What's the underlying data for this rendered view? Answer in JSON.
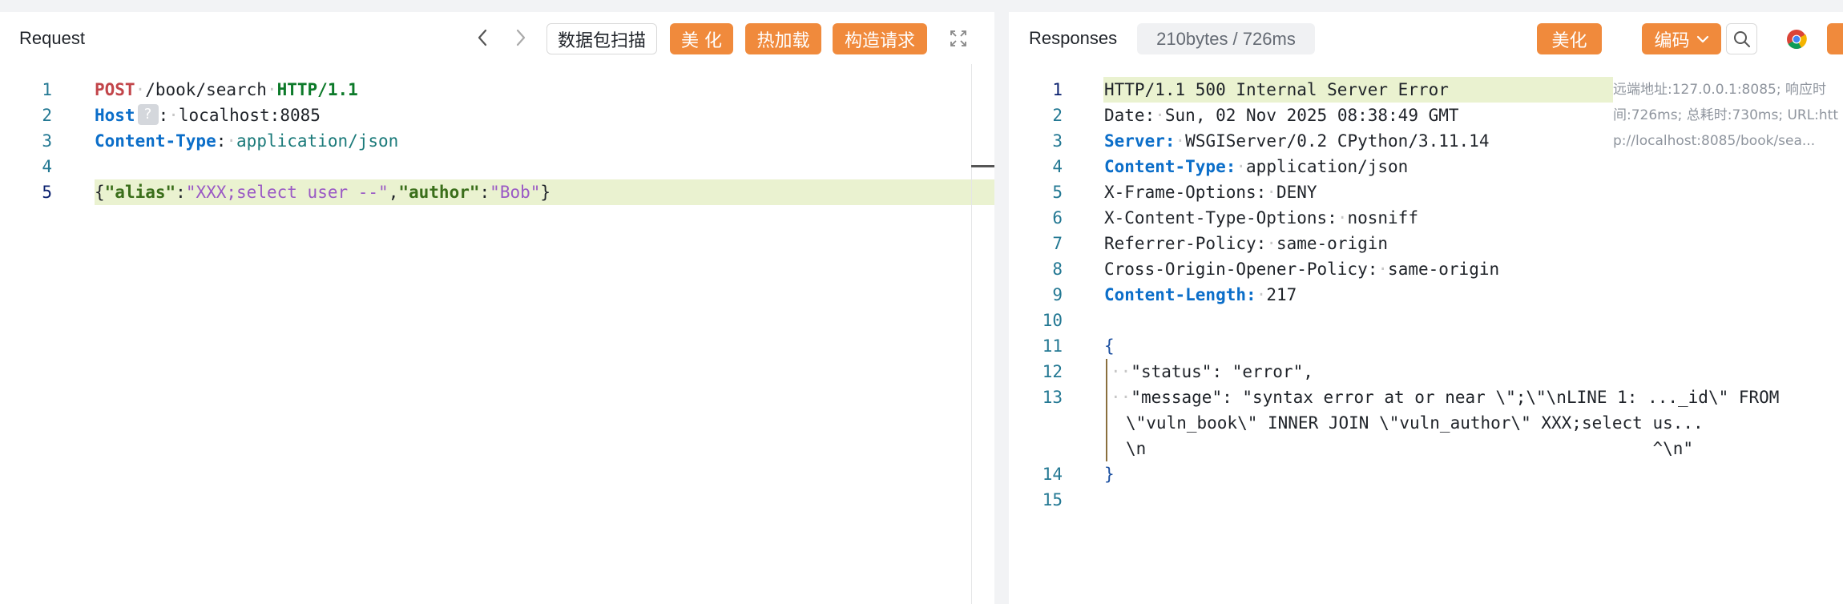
{
  "request": {
    "title": "Request",
    "buttons": {
      "scan": "数据包扫描",
      "beautify": "美 化",
      "hot_reload": "热加载",
      "build_request": "构造请求"
    },
    "lines": [
      {
        "num": "1",
        "method": "POST",
        "path": "/book/search",
        "protocol": "HTTP/1.1"
      },
      {
        "num": "2",
        "key": "Host",
        "qmark": "?",
        "value": "localhost:8085"
      },
      {
        "num": "3",
        "key": "Content-Type",
        "value": "application/json"
      },
      {
        "num": "4"
      },
      {
        "num": "5",
        "k1": "\"alias\"",
        "v1": "\"XXX;select user --\"",
        "k2": "\"author\"",
        "v2": "\"Bob\""
      }
    ]
  },
  "response": {
    "title": "Responses",
    "size_time": "210bytes / 726ms",
    "buttons": {
      "beautify": "美化",
      "encoding": "编码"
    },
    "meta": {
      "line1": "远端地址:127.0.0.1:8085; 响应时",
      "line2": "间:726ms; 总耗时:730ms; URL:htt",
      "line3": "p://localhost:8085/book/sea..."
    },
    "lines": [
      {
        "num": "1",
        "text": "HTTP/1.1 500 Internal Server Error"
      },
      {
        "num": "2",
        "key": "Date",
        "value": "Sun, 02 Nov 2025 08:38:49 GMT"
      },
      {
        "num": "3",
        "key": "Server",
        "value": "WSGIServer/0.2 CPython/3.11.14"
      },
      {
        "num": "4",
        "key": "Content-Type",
        "value": "application/json"
      },
      {
        "num": "5",
        "key": "X-Frame-Options",
        "value": "DENY"
      },
      {
        "num": "6",
        "key": "X-Content-Type-Options",
        "value": "nosniff"
      },
      {
        "num": "7",
        "key": "Referrer-Policy",
        "value": "same-origin"
      },
      {
        "num": "8",
        "key": "Cross-Origin-Opener-Policy",
        "value": "same-origin"
      },
      {
        "num": "9",
        "key": "Content-Length",
        "value": "217"
      },
      {
        "num": "10"
      },
      {
        "num": "11",
        "text": "{"
      },
      {
        "num": "12",
        "text": "\"status\": \"error\","
      },
      {
        "num": "13",
        "text": "\"message\": \"syntax error at or near \\\";\\\"\\nLINE 1: ..._id\\\" FROM",
        "cont1": "\\\"vuln_book\\\" INNER JOIN \\\"vuln_author\\\" XXX;select us...",
        "cont2": "\\n                                                  ^\\n\""
      },
      {
        "num": "14",
        "text": "}"
      },
      {
        "num": "15"
      }
    ]
  },
  "colors": {
    "accent": "#f08a3c",
    "highlight_line": "#eaf2d0",
    "method": "#c2454a",
    "header_key": "#0b6ec9",
    "json_key": "#3a6e1a",
    "json_string": "#9a59c5"
  }
}
